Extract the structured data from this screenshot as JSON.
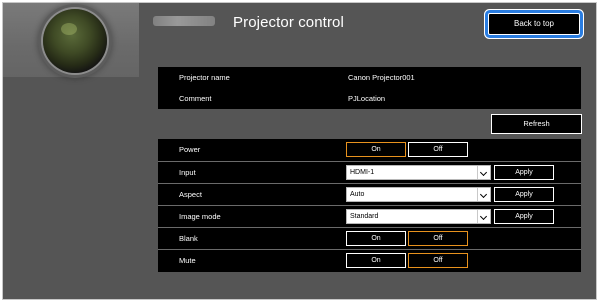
{
  "header": {
    "title": "Projector control",
    "back_label": "Back to top",
    "icons": [
      "projector-lens-icon",
      "brand-logo-icon"
    ],
    "accent": "#2a7de1"
  },
  "info": {
    "rows": [
      {
        "label": "Projector name",
        "value": "Canon Projector001"
      },
      {
        "label": "Comment",
        "value": "PJLocation"
      }
    ]
  },
  "refresh_label": "Refresh",
  "controls": {
    "power": {
      "label": "Power",
      "on": "On",
      "off": "Off",
      "active": "on"
    },
    "input": {
      "label": "Input",
      "value": "HDMI-1",
      "apply": "Apply"
    },
    "aspect": {
      "label": "Aspect",
      "value": "Auto",
      "apply": "Apply"
    },
    "image_mode": {
      "label": "Image mode",
      "value": "Standard",
      "apply": "Apply"
    },
    "blank": {
      "label": "Blank",
      "on": "On",
      "off": "Off",
      "active": "off"
    },
    "mute": {
      "label": "Mute",
      "on": "On",
      "off": "Off",
      "active": "off"
    }
  },
  "colors": {
    "panel": "#555555",
    "table": "#000000",
    "active_border": "#e8921e"
  }
}
